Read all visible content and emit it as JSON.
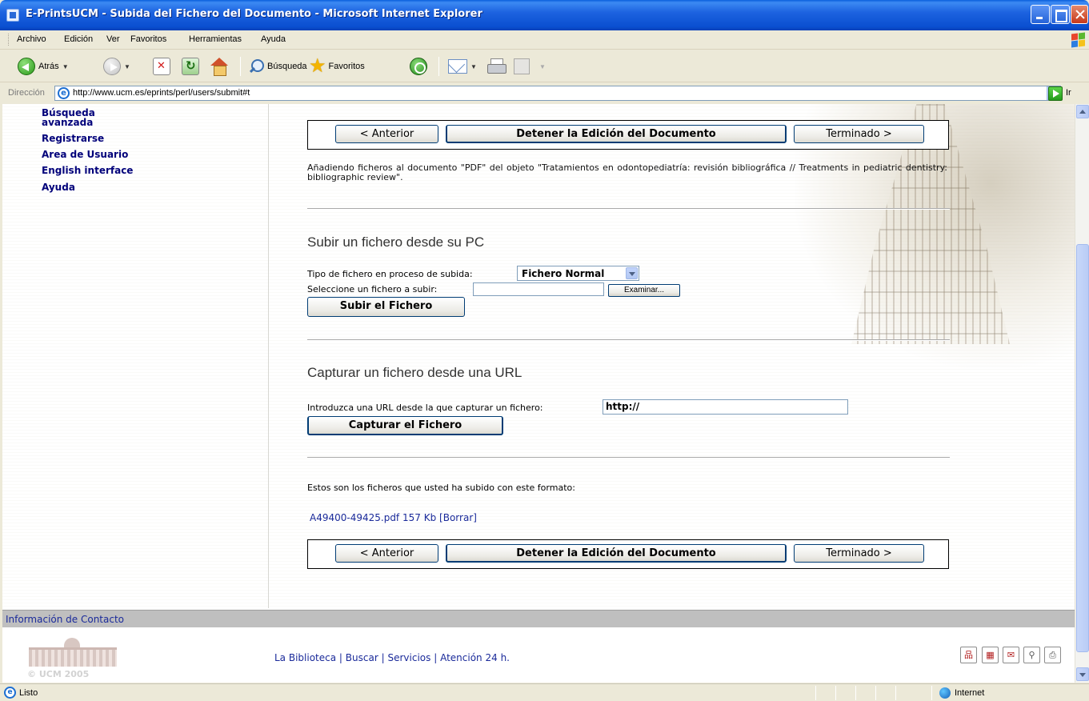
{
  "window": {
    "title": "E-PrintsUCM - Subida del Fichero del Documento - Microsoft Internet Explorer"
  },
  "menu": [
    "Archivo",
    "Edición",
    "Ver",
    "Favoritos",
    "Herramientas",
    "Ayuda"
  ],
  "toolbar": {
    "back_label": "Atrás",
    "search_label": "Búsqueda",
    "favorites_label": "Favoritos"
  },
  "address": {
    "label": "Dirección",
    "url": "http://www.ucm.es/eprints/perl/users/submit#t",
    "go_label": "Ir"
  },
  "sidebar": {
    "items": [
      {
        "label": "Búsqueda"
      },
      {
        "label": "avanzada"
      },
      {
        "label": "Registrarse"
      },
      {
        "label": "Area de Usuario"
      },
      {
        "label": "English interface"
      },
      {
        "label": "Ayuda"
      }
    ]
  },
  "nav_buttons": {
    "previous": "< Anterior",
    "stop": "Detener la Edición del Documento",
    "done": "Terminado >"
  },
  "main": {
    "intro": "Añadiendo ficheros al documento \"PDF\" del objeto \"Tratamientos en odontopediatría: revisión bibliográfica // Treatments in pediatric dentistry: bibliographic review\".",
    "upload_section": {
      "title": "Subir un fichero desde su PC",
      "file_type_label": "Tipo de fichero en proceso de subida:",
      "file_type_value": "Fichero Normal",
      "select_file_label": "Seleccione un fichero a subir:",
      "file_input_value": "",
      "browse_label": "Examinar...",
      "submit_label": "Subir el Fichero"
    },
    "url_section": {
      "title": "Capturar un fichero desde una URL",
      "url_label": "Introduzca una URL desde la que capturar un fichero:",
      "url_value": "http://",
      "submit_label": "Capturar el Fichero"
    },
    "uploaded": {
      "label": "Estos son los ficheros que usted ha subido con este formato:",
      "file_name": "A49400-49425.pdf",
      "file_size": "157 Kb",
      "delete_label": "[Borrar]"
    }
  },
  "footer": {
    "contact": "Información de Contacto",
    "copyright": "© UCM 2005",
    "links": [
      "La Biblioteca",
      "Buscar",
      "Servicios",
      "Atención 24 h."
    ],
    "separator": "|"
  },
  "statusbar": {
    "text": "Listo",
    "zone": "Internet"
  },
  "colors": {
    "titlebar": "#0a4fd0",
    "nav_link": "#00007a",
    "content_link": "#1a2a9a",
    "contact_bar": "#bfbfbf"
  }
}
